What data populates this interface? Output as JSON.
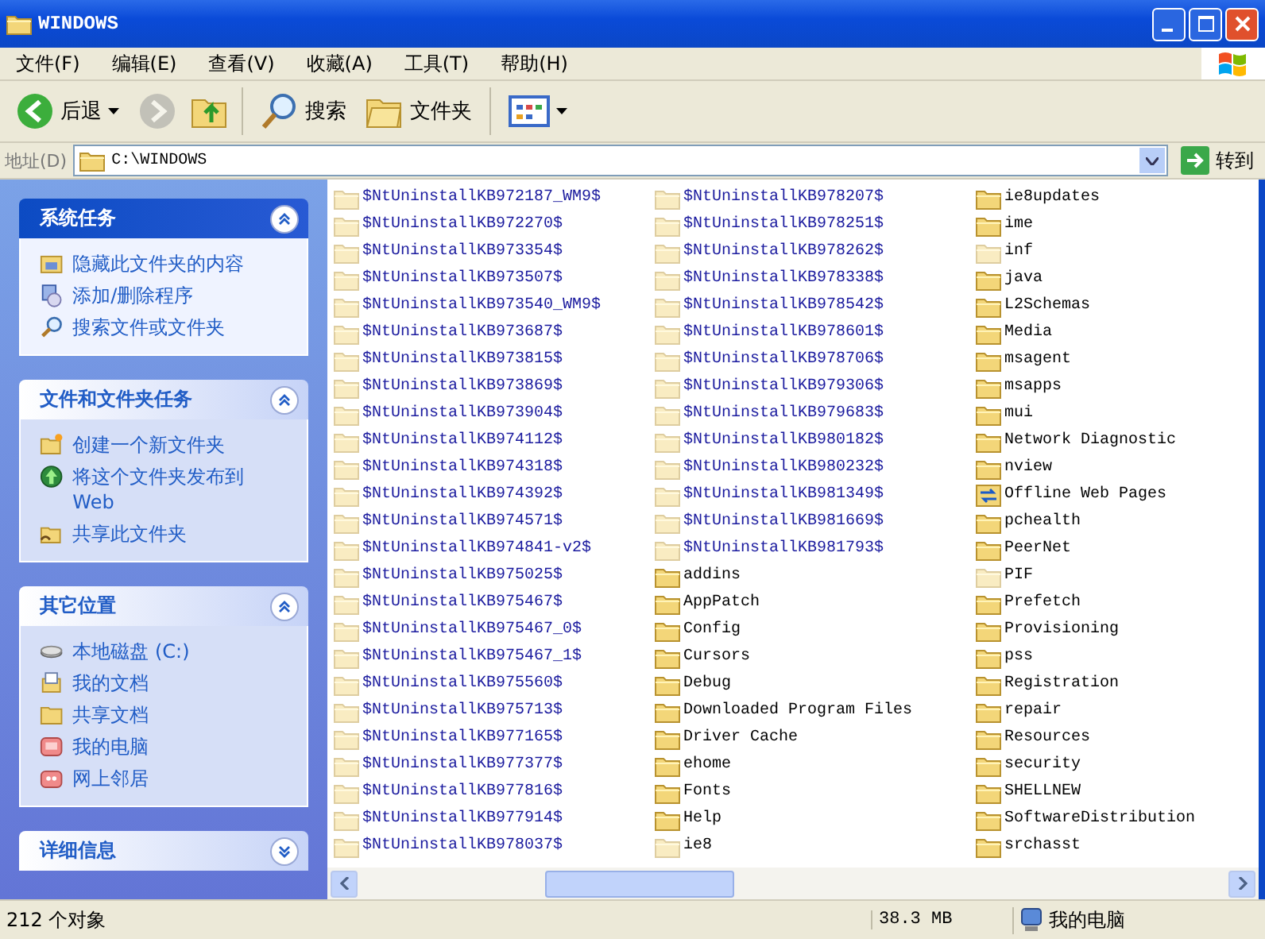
{
  "window": {
    "title": "WINDOWS"
  },
  "menu": [
    "文件(F)",
    "编辑(E)",
    "查看(V)",
    "收藏(A)",
    "工具(T)",
    "帮助(H)"
  ],
  "toolbar": {
    "back": {
      "label": "后退",
      "disabled": false
    },
    "forward": {
      "disabled": true
    },
    "search": "搜索",
    "folders": "文件夹"
  },
  "address": {
    "label": "地址(D)",
    "value": "C:\\WINDOWS",
    "go": "转到"
  },
  "sidebar": [
    {
      "title": "系统任务",
      "kind": "special",
      "expanded": true,
      "items": [
        "隐藏此文件夹的内容",
        "添加/删除程序",
        "搜索文件或文件夹"
      ]
    },
    {
      "title": "文件和文件夹任务",
      "kind": "normal",
      "expanded": true,
      "items": [
        "创建一个新文件夹",
        "将这个文件夹发布到 Web",
        "共享此文件夹"
      ]
    },
    {
      "title": "其它位置",
      "kind": "normal",
      "expanded": true,
      "items": [
        "本地磁盘 (C:)",
        "我的文档",
        "共享文档",
        "我的电脑",
        "网上邻居"
      ]
    },
    {
      "title": "详细信息",
      "kind": "normal",
      "expanded": false
    }
  ],
  "files": [
    {
      "name": "$NtUninstallKB972187_WM9$",
      "kind": "folder",
      "hidden": true,
      "compressed": true
    },
    {
      "name": "$NtUninstallKB972270$",
      "kind": "folder",
      "hidden": true,
      "compressed": true
    },
    {
      "name": "$NtUninstallKB973354$",
      "kind": "folder",
      "hidden": true,
      "compressed": true
    },
    {
      "name": "$NtUninstallKB973507$",
      "kind": "folder",
      "hidden": true,
      "compressed": true
    },
    {
      "name": "$NtUninstallKB973540_WM9$",
      "kind": "folder",
      "hidden": true,
      "compressed": true
    },
    {
      "name": "$NtUninstallKB973687$",
      "kind": "folder",
      "hidden": true,
      "compressed": true
    },
    {
      "name": "$NtUninstallKB973815$",
      "kind": "folder",
      "hidden": true,
      "compressed": true
    },
    {
      "name": "$NtUninstallKB973869$",
      "kind": "folder",
      "hidden": true,
      "compressed": true
    },
    {
      "name": "$NtUninstallKB973904$",
      "kind": "folder",
      "hidden": true,
      "compressed": true
    },
    {
      "name": "$NtUninstallKB974112$",
      "kind": "folder",
      "hidden": true,
      "compressed": true
    },
    {
      "name": "$NtUninstallKB974318$",
      "kind": "folder",
      "hidden": true,
      "compressed": true
    },
    {
      "name": "$NtUninstallKB974392$",
      "kind": "folder",
      "hidden": true,
      "compressed": true
    },
    {
      "name": "$NtUninstallKB974571$",
      "kind": "folder",
      "hidden": true,
      "compressed": true
    },
    {
      "name": "$NtUninstallKB974841-v2$",
      "kind": "folder",
      "hidden": true,
      "compressed": true
    },
    {
      "name": "$NtUninstallKB975025$",
      "kind": "folder",
      "hidden": true,
      "compressed": true
    },
    {
      "name": "$NtUninstallKB975467$",
      "kind": "folder",
      "hidden": true,
      "compressed": true
    },
    {
      "name": "$NtUninstallKB975467_0$",
      "kind": "folder",
      "hidden": true,
      "compressed": true
    },
    {
      "name": "$NtUninstallKB975467_1$",
      "kind": "folder",
      "hidden": true,
      "compressed": true
    },
    {
      "name": "$NtUninstallKB975560$",
      "kind": "folder",
      "hidden": true,
      "compressed": true
    },
    {
      "name": "$NtUninstallKB975713$",
      "kind": "folder",
      "hidden": true,
      "compressed": true
    },
    {
      "name": "$NtUninstallKB977165$",
      "kind": "folder",
      "hidden": true,
      "compressed": true
    },
    {
      "name": "$NtUninstallKB977377$",
      "kind": "folder",
      "hidden": true,
      "compressed": true
    },
    {
      "name": "$NtUninstallKB977816$",
      "kind": "folder",
      "hidden": true,
      "compressed": true
    },
    {
      "name": "$NtUninstallKB977914$",
      "kind": "folder",
      "hidden": true,
      "compressed": true
    },
    {
      "name": "$NtUninstallKB978037$",
      "kind": "folder",
      "hidden": true,
      "compressed": true
    },
    {
      "name": "$NtUninstallKB978207$",
      "kind": "folder",
      "hidden": true,
      "compressed": true
    },
    {
      "name": "$NtUninstallKB978251$",
      "kind": "folder",
      "hidden": true,
      "compressed": true
    },
    {
      "name": "$NtUninstallKB978262$",
      "kind": "folder",
      "hidden": true,
      "compressed": true
    },
    {
      "name": "$NtUninstallKB978338$",
      "kind": "folder",
      "hidden": true,
      "compressed": true
    },
    {
      "name": "$NtUninstallKB978542$",
      "kind": "folder",
      "hidden": true,
      "compressed": true
    },
    {
      "name": "$NtUninstallKB978601$",
      "kind": "folder",
      "hidden": true,
      "compressed": true
    },
    {
      "name": "$NtUninstallKB978706$",
      "kind": "folder",
      "hidden": true,
      "compressed": true
    },
    {
      "name": "$NtUninstallKB979306$",
      "kind": "folder",
      "hidden": true,
      "compressed": true
    },
    {
      "name": "$NtUninstallKB979683$",
      "kind": "folder",
      "hidden": true,
      "compressed": true
    },
    {
      "name": "$NtUninstallKB980182$",
      "kind": "folder",
      "hidden": true,
      "compressed": true
    },
    {
      "name": "$NtUninstallKB980232$",
      "kind": "folder",
      "hidden": true,
      "compressed": true
    },
    {
      "name": "$NtUninstallKB981349$",
      "kind": "folder",
      "hidden": true,
      "compressed": true
    },
    {
      "name": "$NtUninstallKB981669$",
      "kind": "folder",
      "hidden": true,
      "compressed": true
    },
    {
      "name": "$NtUninstallKB981793$",
      "kind": "folder",
      "hidden": true,
      "compressed": true
    },
    {
      "name": "addins",
      "kind": "folder",
      "hidden": false,
      "compressed": false
    },
    {
      "name": "AppPatch",
      "kind": "folder",
      "hidden": false,
      "compressed": false
    },
    {
      "name": "Config",
      "kind": "folder",
      "hidden": false,
      "compressed": false
    },
    {
      "name": "Cursors",
      "kind": "folder",
      "hidden": false,
      "compressed": false
    },
    {
      "name": "Debug",
      "kind": "folder",
      "hidden": false,
      "compressed": false
    },
    {
      "name": "Downloaded Program Files",
      "kind": "folder",
      "hidden": false,
      "compressed": false
    },
    {
      "name": "Driver Cache",
      "kind": "folder",
      "hidden": false,
      "compressed": false
    },
    {
      "name": "ehome",
      "kind": "folder",
      "hidden": false,
      "compressed": false
    },
    {
      "name": "Fonts",
      "kind": "folder",
      "hidden": false,
      "compressed": false
    },
    {
      "name": "Help",
      "kind": "folder",
      "hidden": false,
      "compressed": false
    },
    {
      "name": "ie8",
      "kind": "folder",
      "hidden": true,
      "compressed": false
    },
    {
      "name": "ie8updates",
      "kind": "folder",
      "hidden": false,
      "compressed": false
    },
    {
      "name": "ime",
      "kind": "folder",
      "hidden": false,
      "compressed": false
    },
    {
      "name": "inf",
      "kind": "folder",
      "hidden": true,
      "compressed": false
    },
    {
      "name": "java",
      "kind": "folder",
      "hidden": false,
      "compressed": false
    },
    {
      "name": "L2Schemas",
      "kind": "folder",
      "hidden": false,
      "compressed": false
    },
    {
      "name": "Media",
      "kind": "folder",
      "hidden": false,
      "compressed": false
    },
    {
      "name": "msagent",
      "kind": "folder",
      "hidden": false,
      "compressed": false
    },
    {
      "name": "msapps",
      "kind": "folder",
      "hidden": false,
      "compressed": false
    },
    {
      "name": "mui",
      "kind": "folder",
      "hidden": false,
      "compressed": false
    },
    {
      "name": "Network Diagnostic",
      "kind": "folder",
      "hidden": false,
      "compressed": false
    },
    {
      "name": "nview",
      "kind": "folder",
      "hidden": false,
      "compressed": false
    },
    {
      "name": "Offline Web Pages",
      "kind": "offline",
      "hidden": false,
      "compressed": false
    },
    {
      "name": "pchealth",
      "kind": "folder",
      "hidden": false,
      "compressed": false
    },
    {
      "name": "PeerNet",
      "kind": "folder",
      "hidden": false,
      "compressed": false
    },
    {
      "name": "PIF",
      "kind": "folder",
      "hidden": true,
      "compressed": false
    },
    {
      "name": "Prefetch",
      "kind": "folder",
      "hidden": false,
      "compressed": false
    },
    {
      "name": "Provisioning",
      "kind": "folder",
      "hidden": false,
      "compressed": false
    },
    {
      "name": "pss",
      "kind": "folder",
      "hidden": false,
      "compressed": false
    },
    {
      "name": "Registration",
      "kind": "folder",
      "hidden": false,
      "compressed": false
    },
    {
      "name": "repair",
      "kind": "folder",
      "hidden": false,
      "compressed": false
    },
    {
      "name": "Resources",
      "kind": "folder",
      "hidden": false,
      "compressed": false
    },
    {
      "name": "security",
      "kind": "folder",
      "hidden": false,
      "compressed": false
    },
    {
      "name": "SHELLNEW",
      "kind": "folder",
      "hidden": false,
      "compressed": false
    },
    {
      "name": "SoftwareDistribution",
      "kind": "folder",
      "hidden": false,
      "compressed": false
    },
    {
      "name": "srchasst",
      "kind": "folder",
      "hidden": false,
      "compressed": false
    }
  ],
  "status_bar": {
    "count": "212 个对象",
    "size": "38.3 MB",
    "location": "我的电脑"
  }
}
